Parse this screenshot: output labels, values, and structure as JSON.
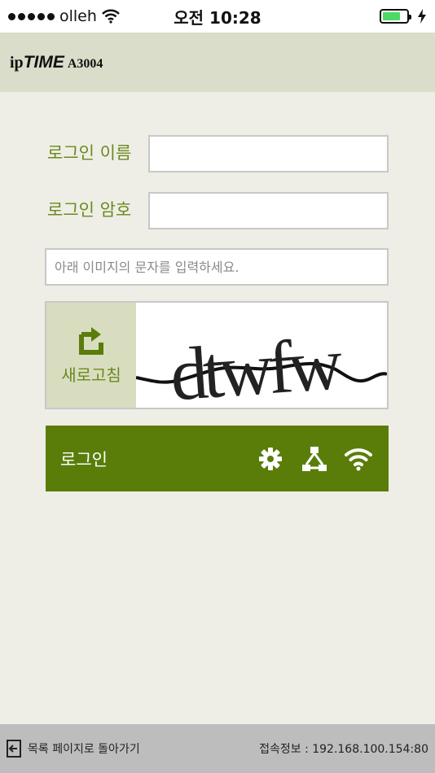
{
  "status_bar": {
    "carrier": "olleh",
    "time": "오전 10:28",
    "battery_percent": 75,
    "battery_color": "#4cd964"
  },
  "header": {
    "brand_ip": "ip",
    "brand_time": "TIME",
    "model": "A3004"
  },
  "login_form": {
    "username_label": "로그인 이름",
    "username_value": "",
    "password_label": "로그인 암호",
    "password_value": "",
    "captcha_input_placeholder": "아래 이미지의 문자를 입력하세요.",
    "captcha_input_value": "",
    "refresh_label": "새로고침",
    "captcha_text": "dtwfw",
    "login_button_label": "로그인",
    "icons": [
      "gear-icon",
      "network-icon",
      "wifi-icon"
    ]
  },
  "colors": {
    "accent_green": "#5a7d0a",
    "label_green": "#6a8a1e",
    "header_bg": "#d9ddc9",
    "body_bg": "#eeeee6"
  },
  "footer": {
    "back_label": "목록 페이지로 돌아가기",
    "connection_info": "접속정보 : 192.168.100.154:80"
  }
}
